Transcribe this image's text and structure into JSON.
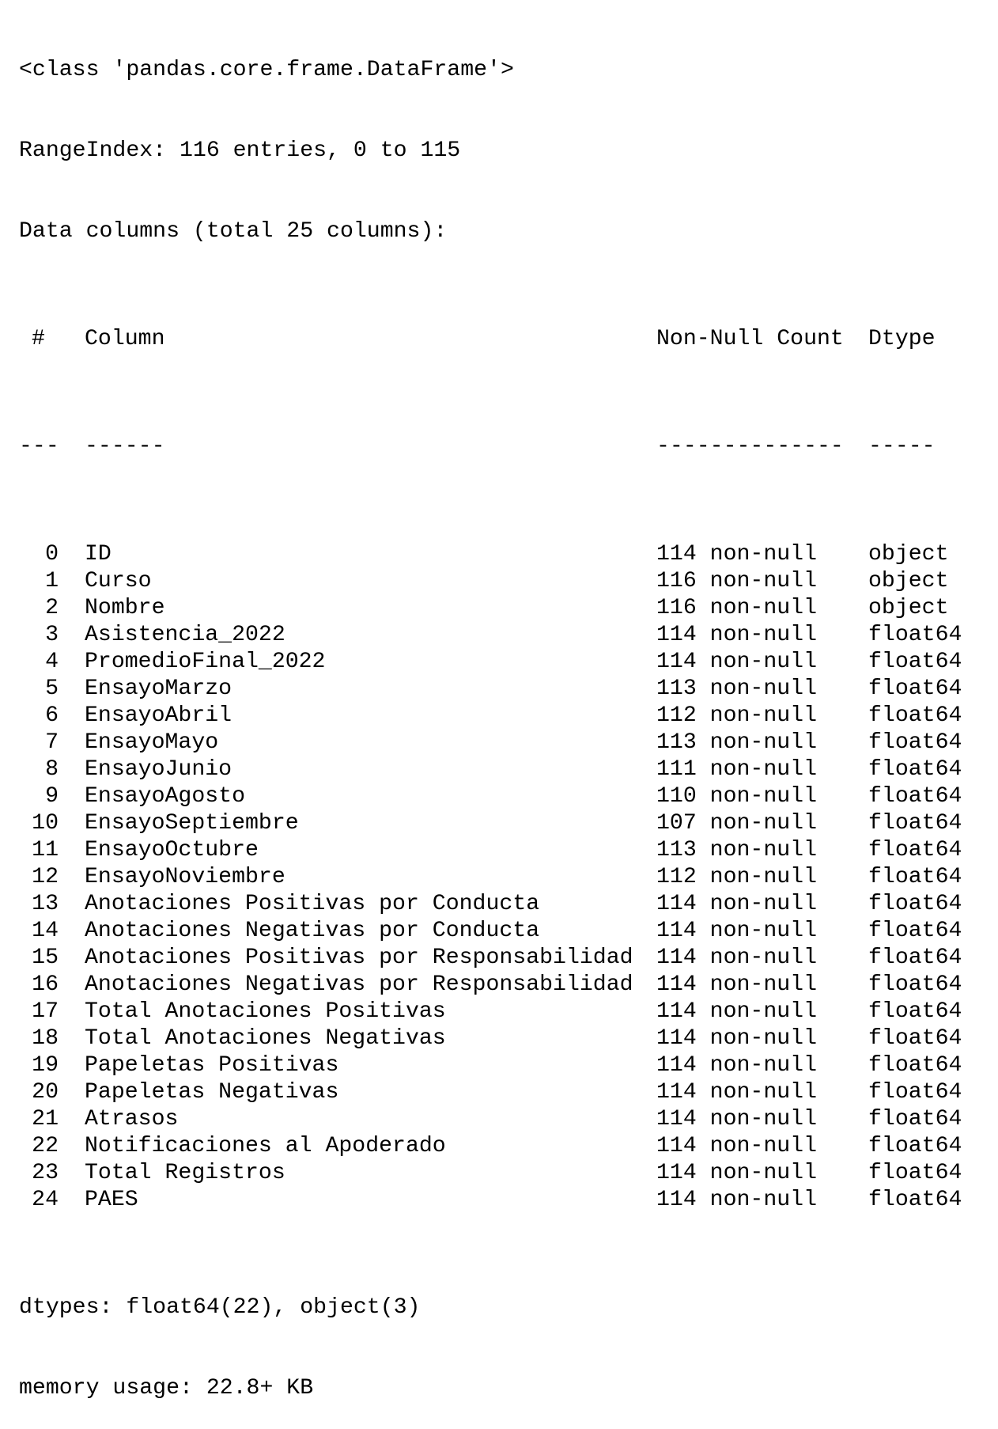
{
  "header": {
    "class_line": "<class 'pandas.core.frame.DataFrame'>",
    "range_index_line": "RangeIndex: 116 entries, 0 to 115",
    "data_columns_line": "Data columns (total 25 columns):"
  },
  "table": {
    "headers": {
      "index": "#",
      "column": "Column",
      "non_null_count": "Non-Null Count",
      "dtype": "Dtype"
    },
    "separators": {
      "index": "---",
      "column": "------",
      "non_null_count": "--------------",
      "dtype": "-----"
    },
    "rows": [
      {
        "index": "0",
        "column": "ID",
        "non_null_count": "114 non-null",
        "dtype": "object"
      },
      {
        "index": "1",
        "column": "Curso",
        "non_null_count": "116 non-null",
        "dtype": "object"
      },
      {
        "index": "2",
        "column": "Nombre",
        "non_null_count": "116 non-null",
        "dtype": "object"
      },
      {
        "index": "3",
        "column": "Asistencia_2022",
        "non_null_count": "114 non-null",
        "dtype": "float64"
      },
      {
        "index": "4",
        "column": "PromedioFinal_2022",
        "non_null_count": "114 non-null",
        "dtype": "float64"
      },
      {
        "index": "5",
        "column": "EnsayoMarzo",
        "non_null_count": "113 non-null",
        "dtype": "float64"
      },
      {
        "index": "6",
        "column": "EnsayoAbril",
        "non_null_count": "112 non-null",
        "dtype": "float64"
      },
      {
        "index": "7",
        "column": "EnsayoMayo",
        "non_null_count": "113 non-null",
        "dtype": "float64"
      },
      {
        "index": "8",
        "column": "EnsayoJunio",
        "non_null_count": "111 non-null",
        "dtype": "float64"
      },
      {
        "index": "9",
        "column": "EnsayoAgosto",
        "non_null_count": "110 non-null",
        "dtype": "float64"
      },
      {
        "index": "10",
        "column": "EnsayoSeptiembre",
        "non_null_count": "107 non-null",
        "dtype": "float64"
      },
      {
        "index": "11",
        "column": "EnsayoOctubre",
        "non_null_count": "113 non-null",
        "dtype": "float64"
      },
      {
        "index": "12",
        "column": "EnsayoNoviembre",
        "non_null_count": "112 non-null",
        "dtype": "float64"
      },
      {
        "index": "13",
        "column": "Anotaciones Positivas por Conducta",
        "non_null_count": "114 non-null",
        "dtype": "float64"
      },
      {
        "index": "14",
        "column": "Anotaciones Negativas por Conducta",
        "non_null_count": "114 non-null",
        "dtype": "float64"
      },
      {
        "index": "15",
        "column": "Anotaciones Positivas por Responsabilidad",
        "non_null_count": "114 non-null",
        "dtype": "float64"
      },
      {
        "index": "16",
        "column": "Anotaciones Negativas por Responsabilidad",
        "non_null_count": "114 non-null",
        "dtype": "float64"
      },
      {
        "index": "17",
        "column": "Total Anotaciones Positivas",
        "non_null_count": "114 non-null",
        "dtype": "float64"
      },
      {
        "index": "18",
        "column": "Total Anotaciones Negativas",
        "non_null_count": "114 non-null",
        "dtype": "float64"
      },
      {
        "index": "19",
        "column": "Papeletas Positivas",
        "non_null_count": "114 non-null",
        "dtype": "float64"
      },
      {
        "index": "20",
        "column": "Papeletas Negativas",
        "non_null_count": "114 non-null",
        "dtype": "float64"
      },
      {
        "index": "21",
        "column": "Atrasos",
        "non_null_count": "114 non-null",
        "dtype": "float64"
      },
      {
        "index": "22",
        "column": "Notificaciones al Apoderado",
        "non_null_count": "114 non-null",
        "dtype": "float64"
      },
      {
        "index": "23",
        "column": "Total Registros",
        "non_null_count": "114 non-null",
        "dtype": "float64"
      },
      {
        "index": "24",
        "column": "PAES",
        "non_null_count": "114 non-null",
        "dtype": "float64"
      }
    ]
  },
  "footer": {
    "dtypes_line": "dtypes: float64(22), object(3)",
    "memory_line": "memory usage: 22.8+ KB"
  }
}
